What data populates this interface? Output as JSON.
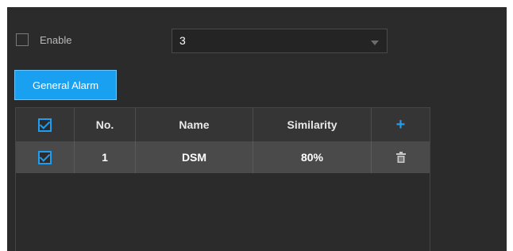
{
  "enable": {
    "label": "Enable",
    "checked": false
  },
  "select": {
    "value": "3"
  },
  "general_alarm_button": "General Alarm",
  "table": {
    "headers": {
      "select_all_checked": true,
      "no": "No.",
      "name": "Name",
      "similarity": "Similarity",
      "add_icon": "plus-icon"
    },
    "rows": [
      {
        "checked": true,
        "no": "1",
        "name": "DSM",
        "similarity": "80%",
        "action_icon": "trash-icon"
      }
    ]
  },
  "colors": {
    "accent": "#1f9df0",
    "panel_bg": "#2b2b2b",
    "header_bg": "#353535",
    "selected_row_bg": "#4a4a4a"
  }
}
